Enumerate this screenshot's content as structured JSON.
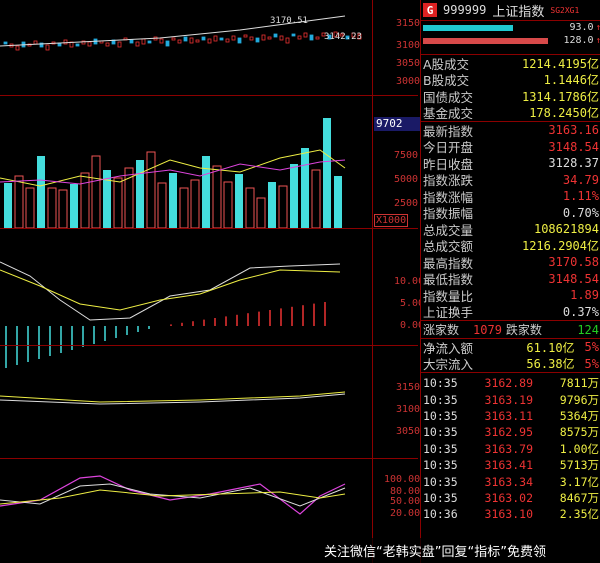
{
  "stock": {
    "badge": "G",
    "code": "999999",
    "name": "上证指数",
    "tag": "SG2XG1"
  },
  "bars": {
    "buy_value": "93.0",
    "sell_value": "128.0"
  },
  "main_chart": {
    "high_label": "3170.51",
    "low_label": "3142.23",
    "axis": [
      "3150",
      "3100",
      "3050",
      "3000"
    ]
  },
  "vol_chart": {
    "indicator": "9702",
    "axis": [
      "7500",
      "5000",
      "2500"
    ],
    "unit": "X1000"
  },
  "macd_chart": {
    "axis": [
      "10.00",
      "5.00",
      "0.00"
    ]
  },
  "ma_chart": {
    "axis": [
      "3150",
      "3100",
      "3050"
    ]
  },
  "kdj_chart": {
    "axis": [
      "100.00",
      "80.00",
      "50.00",
      "20.00"
    ]
  },
  "volume_section": [
    {
      "label": "A股成交",
      "value": "1214.4195亿"
    },
    {
      "label": "B股成交",
      "value": "1.1446亿"
    },
    {
      "label": "国债成交",
      "value": "1314.1786亿"
    },
    {
      "label": "基金成交",
      "value": "178.2450亿"
    }
  ],
  "index_section": [
    {
      "label": "最新指数",
      "value": "3163.16",
      "color": "#ee3333"
    },
    {
      "label": "今日开盘",
      "value": "3148.54",
      "color": "#ee3333"
    },
    {
      "label": "昨日收盘",
      "value": "3128.37",
      "color": "#dddddd"
    },
    {
      "label": "指数涨跌",
      "value": "34.79",
      "color": "#ee3333"
    },
    {
      "label": "指数涨幅",
      "value": "1.11%",
      "color": "#ee3333"
    },
    {
      "label": "指数振幅",
      "value": "0.70%",
      "color": "#dddddd"
    },
    {
      "label": "总成交量",
      "value": "108621894",
      "color": "#eeee44"
    },
    {
      "label": "总成交额",
      "value": "1216.2904亿",
      "color": "#eeee44"
    },
    {
      "label": "最高指数",
      "value": "3170.58",
      "color": "#ee3333"
    },
    {
      "label": "最低指数",
      "value": "3148.54",
      "color": "#ee3333"
    },
    {
      "label": "指数量比",
      "value": "1.89",
      "color": "#ee3333"
    },
    {
      "label": "上证换手",
      "value": "0.37%",
      "color": "#dddddd"
    }
  ],
  "breadth": {
    "up_label": "涨家数",
    "up": "1079",
    "down_label": "跌家数",
    "down": "124"
  },
  "flows": [
    {
      "label": "净流入额",
      "value": "61.10亿",
      "pct": "5%"
    },
    {
      "label": "大宗流入",
      "value": "56.38亿",
      "pct": "5%"
    }
  ],
  "ticks": [
    {
      "time": "10:35",
      "price": "3162.89",
      "vol": "7811万"
    },
    {
      "time": "10:35",
      "price": "3163.19",
      "vol": "9796万"
    },
    {
      "time": "10:35",
      "price": "3163.11",
      "vol": "5364万"
    },
    {
      "time": "10:35",
      "price": "3162.95",
      "vol": "8575万"
    },
    {
      "time": "10:35",
      "price": "3163.79",
      "vol": "1.00亿"
    },
    {
      "time": "10:35",
      "price": "3163.41",
      "vol": "5713万"
    },
    {
      "time": "10:35",
      "price": "3163.34",
      "vol": "3.17亿"
    },
    {
      "time": "10:35",
      "price": "3163.02",
      "vol": "8467万"
    },
    {
      "time": "10:36",
      "price": "3163.10",
      "vol": "2.35亿"
    }
  ],
  "watermark": "关注微信“老韩实盘”回复“指标”免费领"
}
